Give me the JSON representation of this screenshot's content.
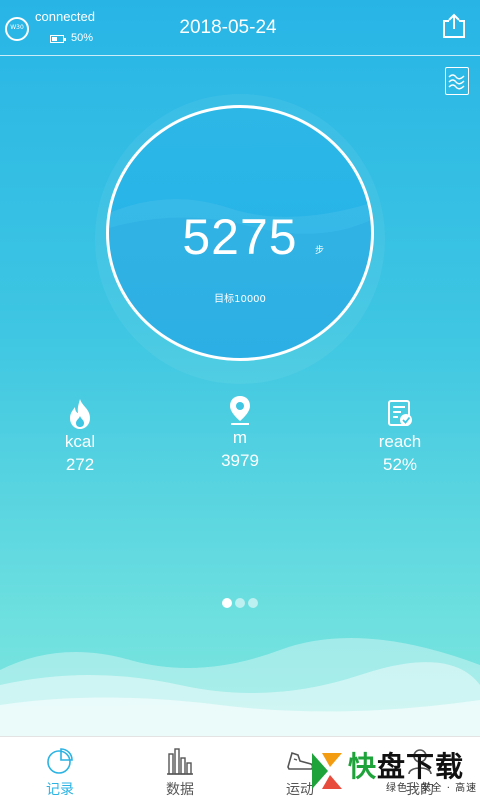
{
  "header": {
    "watch_label": "W30",
    "connection_status": "connected",
    "battery_level": "50%",
    "date": "2018-05-24"
  },
  "ring": {
    "steps": "5275",
    "steps_unit": "步",
    "goal": "目标10000"
  },
  "stats": [
    {
      "icon": "flame-icon",
      "label": "kcal",
      "value": "272"
    },
    {
      "icon": "location-pin-icon",
      "label": "m",
      "value": "3979"
    },
    {
      "icon": "checklist-icon",
      "label": "reach",
      "value": "52%"
    }
  ],
  "pager": {
    "page_count": 3,
    "active_index": 0
  },
  "tabs": [
    {
      "icon": "pie-chart-icon",
      "label": "记录",
      "active": true
    },
    {
      "icon": "bar-chart-icon",
      "label": "数据",
      "active": false
    },
    {
      "icon": "running-shoe-icon",
      "label": "运动",
      "active": false
    },
    {
      "icon": "profile-icon",
      "label": "我的",
      "active": false
    }
  ],
  "watermark": {
    "brand_green": "快",
    "brand_black": "盘下载",
    "tagline": "绿色 · 安全 · 高速"
  },
  "colors": {
    "accent": "#2bb3e4",
    "background_top": "#28b5e6",
    "background_bottom": "#7fe6de",
    "watermark_green": "#1ea33a"
  }
}
